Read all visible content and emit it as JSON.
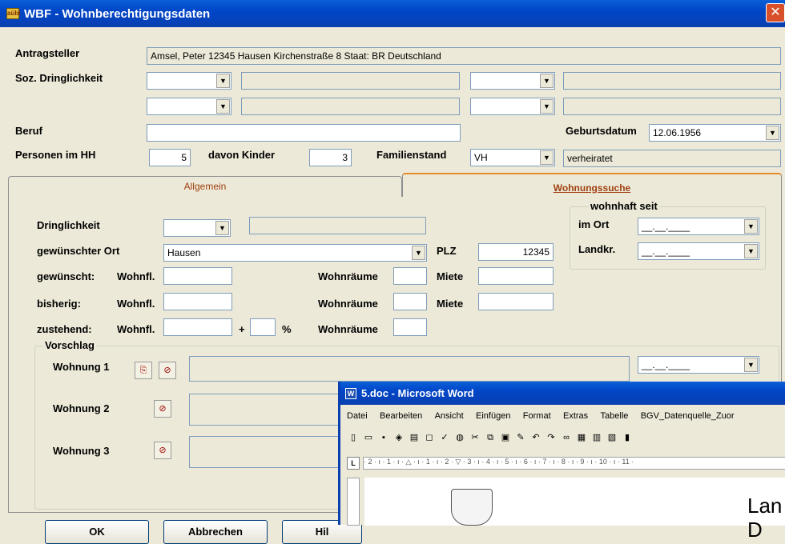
{
  "window": {
    "title": "WBF - Wohnberechtigungsdaten",
    "close": "✕",
    "logo_text": "aübl"
  },
  "labels": {
    "antragsteller": "Antragsteller",
    "soz": "Soz. Dringlichkeit",
    "beruf": "Beruf",
    "geburtsdatum": "Geburtsdatum",
    "personen": "Personen im HH",
    "kinder": "davon Kinder",
    "familienstand": "Familienstand"
  },
  "values": {
    "antragsteller": "Amsel, Peter  12345 Hausen  Kirchenstraße 8   Staat: BR Deutschland",
    "geburtsdatum": "12.06.1956",
    "personen": "5",
    "kinder": "3",
    "familienstand_code": "VH",
    "familienstand_text": "verheiratet"
  },
  "tabs": {
    "allgemein": "Allgemein",
    "wohnungssuche": "Wohnungssuche"
  },
  "wohnungssuche": {
    "dringlichkeit": "Dringlichkeit",
    "gew_ort": "gewünschter Ort",
    "gew_ort_value": "Hausen",
    "plz": "PLZ",
    "plz_value": "12345",
    "gewuenscht": "gewünscht:",
    "bisherig": "bisherig:",
    "zustehend": "zustehend:",
    "wohnfl": "Wohnfl.",
    "wohnraeume": "Wohnräume",
    "miete": "Miete",
    "plus": "+",
    "percent": "%",
    "wohnhaft_seit": "wohnhaft seit",
    "im_ort": "im Ort",
    "landkr": "Landkr.",
    "date_placeholder": "__.__.____",
    "vorschlag": "Vorschlag",
    "wohnung1": "Wohnung 1",
    "wohnung2": "Wohnung 2",
    "wohnung3": "Wohnung 3"
  },
  "buttons": {
    "ok": "OK",
    "abbrechen": "Abbrechen",
    "hilfe": "Hil"
  },
  "word": {
    "title": "5.doc - Microsoft Word",
    "menu": [
      "Datei",
      "Bearbeiten",
      "Ansicht",
      "Einfügen",
      "Format",
      "Extras",
      "Tabelle",
      "BGV_Datenquelle_Zuor"
    ],
    "ruler": "· 2 · ı · 1 · ı · △ · ı · 1 · ı · 2 · ▽ · 3 · ı · 4 · ı · 5 · ı · 6 · ı · 7 · ı · 8 · ı · 9 · ı · 10 · ı · 11 ·",
    "tab_marker": "L",
    "doc_text_1": "Lan",
    "doc_text_2": "D"
  },
  "arrow": "▼"
}
